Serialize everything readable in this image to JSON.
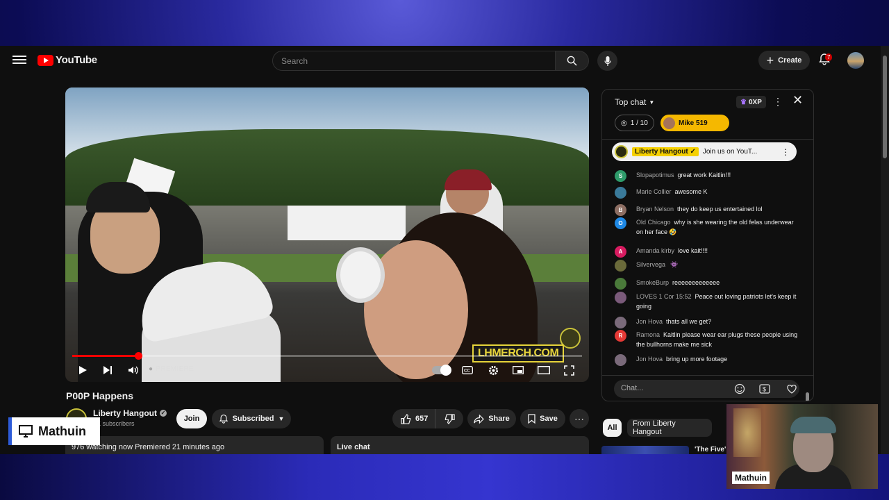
{
  "header": {
    "logo_text": "YouTube",
    "search_placeholder": "Search",
    "create_label": "Create",
    "notifications_count": "7"
  },
  "video": {
    "watermark": "LHMERCH.COM",
    "premiere_label": "PREMIERE",
    "progress_fraction": 0.13
  },
  "meta": {
    "title": "P00P Happens",
    "channel_name": "Liberty Hangout",
    "subscribers": "4K subscribers",
    "join_label": "Join",
    "subscribed_label": "Subscribed",
    "likes": "657",
    "share_label": "Share",
    "save_label": "Save",
    "views_line": "976 watching now  Premiered 21 minutes ago",
    "live_chat_label": "Live chat"
  },
  "chat": {
    "mode_label": "Top chat",
    "xp_label": "0XP",
    "goal_label": "1 / 10",
    "highlight_user": "Mike 519",
    "pinned": {
      "author": "Liberty Hangout",
      "message": "Join us on YouT..."
    },
    "input_placeholder": "Chat...",
    "messages": [
      {
        "author": "Slopapotimus",
        "text": "great work Kaitlin!!!",
        "avatar": "S",
        "color": "#2e9b6a"
      },
      {
        "author": "Marie Collier",
        "text": "awesome K",
        "avatar": "",
        "color": "#3a7a9a"
      },
      {
        "author": "Bryan Nelson",
        "text": "they do keep us entertained lol",
        "avatar": "B",
        "color": "#8d6e63"
      },
      {
        "author": "Old Chicago",
        "text": "why is she wearing the old felas underwear on her face",
        "avatar": "O",
        "color": "#1e88e5",
        "emoji": "🤣"
      },
      {
        "author": "Amanda kirby",
        "text": "love kait!!!!",
        "avatar": "A",
        "color": "#d81b60"
      },
      {
        "author": "Silvervega",
        "text": "",
        "avatar": "",
        "color": "#6a6a3a",
        "emoji": "👾"
      },
      {
        "author": "SmokeBurp",
        "text": "reeeeeeeeeeeee",
        "avatar": "",
        "color": "#4a7a3a"
      },
      {
        "author": "LOVES 1 Cor 15:52",
        "text": "Peace out loving patriots let's keep it going",
        "avatar": "",
        "color": "#7a5a7a"
      },
      {
        "author": "Jon Hova",
        "text": "thats all we get?",
        "avatar": "",
        "color": "#7a6a7a"
      },
      {
        "author": "Ramona",
        "text": "Kaitlin please wear ear plugs these people using the bullhorns make me sick",
        "avatar": "R",
        "color": "#e53935"
      },
      {
        "author": "Jon Hova",
        "text": "bring up more footage",
        "avatar": "",
        "color": "#7a6a7a"
      }
    ]
  },
  "chips": [
    "All",
    "From Liberty Hangout"
  ],
  "recommendation": {
    "title": "'The Five':"
  },
  "overlay": {
    "name_tag": "Mathuin",
    "webcam_label": "Mathuin"
  }
}
